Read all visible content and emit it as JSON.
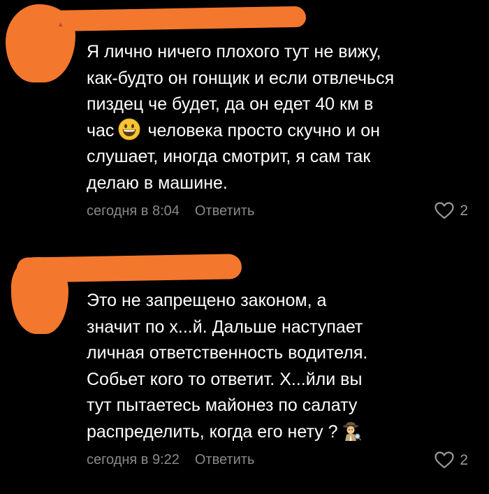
{
  "colors": {
    "background": "#000000",
    "text": "#ffffff",
    "meta": "#8a8a8a",
    "redaction": "#f4772e"
  },
  "comments": [
    {
      "lines": [
        "Я лично ничего плохого тут не вижу,",
        "как-будто он гонщик и если отвлечься",
        "пиздец че будет, да он едет 40 км в",
        "час",
        "человека просто скучно и он",
        "слушает, иногда  смотрит, я сам так",
        "делаю в машине."
      ],
      "inline_icon": "grinning-face-emoji",
      "time": "сегодня в 8:04",
      "reply_label": "Ответить",
      "likes": "2",
      "like_icon": "heart-outline-icon"
    },
    {
      "lines": [
        "Это не запрещено законом, а",
        "значит по х...й. Дальше наступает",
        "личная ответственность водителя.",
        "Собьет кого то ответит. Х...йли вы",
        "тут пытаетесь майонез по салату",
        "распределить, когда его нету ?"
      ],
      "inline_icon": "detective-emoji",
      "time": "сегодня в 9:22",
      "reply_label": "Ответить",
      "likes": "2",
      "like_icon": "heart-outline-icon"
    }
  ]
}
